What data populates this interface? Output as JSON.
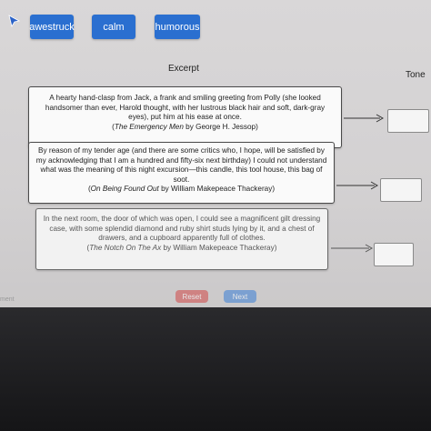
{
  "tiles": [
    {
      "label": "awestruck"
    },
    {
      "label": "calm"
    },
    {
      "label": "humorous"
    }
  ],
  "columns": {
    "excerpt": "Excerpt",
    "tone": "Tone"
  },
  "excerpts": [
    {
      "text": "A hearty hand-clasp from Jack, a frank and smiling greeting from Polly (she looked handsomer than ever, Harold thought, with her lustrous black hair and soft, dark-gray eyes), put him at his ease at once.",
      "source_title": "The Emergency Men",
      "source_author": "by George H. Jessop"
    },
    {
      "text": "By reason of my tender age (and there are some critics who, I hope, will be satisfied by my acknowledging that I am a hundred and fifty-six next birthday) I could not understand what was the meaning of this night excursion—this candle, this tool house, this bag of soot.",
      "source_title": "On Being Found Out",
      "source_author": "by William Makepeace Thackeray"
    },
    {
      "text": "In the next room, the door of which was open, I could see a magnificent gilt dressing case, with some splendid diamond and ruby shirt studs lying by it, and a chest of drawers, and a cupboard apparently full of clothes.",
      "source_title": "The Notch On The Ax",
      "source_author": "by William Makepeace Thackeray"
    }
  ],
  "buttons": {
    "reset": "Reset",
    "next": "Next"
  },
  "footer_hint": "ment",
  "icons": [
    "cursor-arrow-icon",
    "arrow-right-icon"
  ]
}
